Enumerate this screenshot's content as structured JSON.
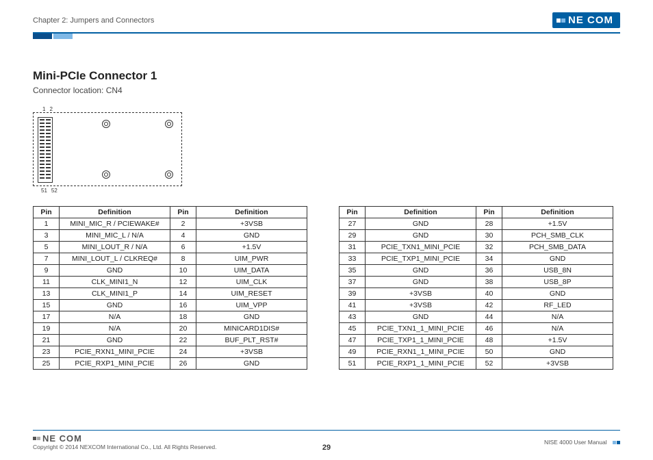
{
  "header": {
    "chapter": "Chapter 2: Jumpers and Connectors",
    "brand": "NE COM"
  },
  "section": {
    "title": "Mini-PCIe Connector 1",
    "subtitle": "Connector location: CN4"
  },
  "diagram": {
    "top_labels": [
      "1",
      "2"
    ],
    "bottom_labels": [
      "51",
      "52"
    ]
  },
  "tables": {
    "headers": [
      "Pin",
      "Definition",
      "Pin",
      "Definition"
    ],
    "left": [
      {
        "p1": "1",
        "d1": "MINI_MIC_R / PCIEWAKE#",
        "p2": "2",
        "d2": "+3VSB"
      },
      {
        "p1": "3",
        "d1": "MINI_MIC_L / N/A",
        "p2": "4",
        "d2": "GND"
      },
      {
        "p1": "5",
        "d1": "MINI_LOUT_R / N/A",
        "p2": "6",
        "d2": "+1.5V"
      },
      {
        "p1": "7",
        "d1": "MINI_LOUT_L / CLKREQ#",
        "p2": "8",
        "d2": "UIM_PWR"
      },
      {
        "p1": "9",
        "d1": "GND",
        "p2": "10",
        "d2": "UIM_DATA"
      },
      {
        "p1": "11",
        "d1": "CLK_MINI1_N",
        "p2": "12",
        "d2": "UIM_CLK"
      },
      {
        "p1": "13",
        "d1": "CLK_MINI1_P",
        "p2": "14",
        "d2": "UIM_RESET"
      },
      {
        "p1": "15",
        "d1": "GND",
        "p2": "16",
        "d2": "UIM_VPP"
      },
      {
        "p1": "17",
        "d1": "N/A",
        "p2": "18",
        "d2": "GND"
      },
      {
        "p1": "19",
        "d1": "N/A",
        "p2": "20",
        "d2": "MINICARD1DIS#"
      },
      {
        "p1": "21",
        "d1": "GND",
        "p2": "22",
        "d2": "BUF_PLT_RST#"
      },
      {
        "p1": "23",
        "d1": "PCIE_RXN1_MINI_PCIE",
        "p2": "24",
        "d2": "+3VSB"
      },
      {
        "p1": "25",
        "d1": "PCIE_RXP1_MINI_PCIE",
        "p2": "26",
        "d2": "GND"
      }
    ],
    "right": [
      {
        "p1": "27",
        "d1": "GND",
        "p2": "28",
        "d2": "+1.5V"
      },
      {
        "p1": "29",
        "d1": "GND",
        "p2": "30",
        "d2": "PCH_SMB_CLK"
      },
      {
        "p1": "31",
        "d1": "PCIE_TXN1_MINI_PCIE",
        "p2": "32",
        "d2": "PCH_SMB_DATA"
      },
      {
        "p1": "33",
        "d1": "PCIE_TXP1_MINI_PCIE",
        "p2": "34",
        "d2": "GND"
      },
      {
        "p1": "35",
        "d1": "GND",
        "p2": "36",
        "d2": "USB_8N"
      },
      {
        "p1": "37",
        "d1": "GND",
        "p2": "38",
        "d2": "USB_8P"
      },
      {
        "p1": "39",
        "d1": "+3VSB",
        "p2": "40",
        "d2": "GND"
      },
      {
        "p1": "41",
        "d1": "+3VSB",
        "p2": "42",
        "d2": "RF_LED"
      },
      {
        "p1": "43",
        "d1": "GND",
        "p2": "44",
        "d2": "N/A"
      },
      {
        "p1": "45",
        "d1": "PCIE_TXN1_1_MINI_PCIE",
        "p2": "46",
        "d2": "N/A"
      },
      {
        "p1": "47",
        "d1": "PCIE_TXP1_1_MINI_PCIE",
        "p2": "48",
        "d2": "+1.5V"
      },
      {
        "p1": "49",
        "d1": "PCIE_RXN1_1_MINI_PCIE",
        "p2": "50",
        "d2": "GND"
      },
      {
        "p1": "51",
        "d1": "PCIE_RXP1_1_MINI_PCIE",
        "p2": "52",
        "d2": "+3VSB"
      }
    ]
  },
  "footer": {
    "copyright": "Copyright © 2014 NEXCOM International Co., Ltd. All Rights Reserved.",
    "page": "29",
    "manual": "NISE 4000 User Manual",
    "brand": "NE COM"
  }
}
